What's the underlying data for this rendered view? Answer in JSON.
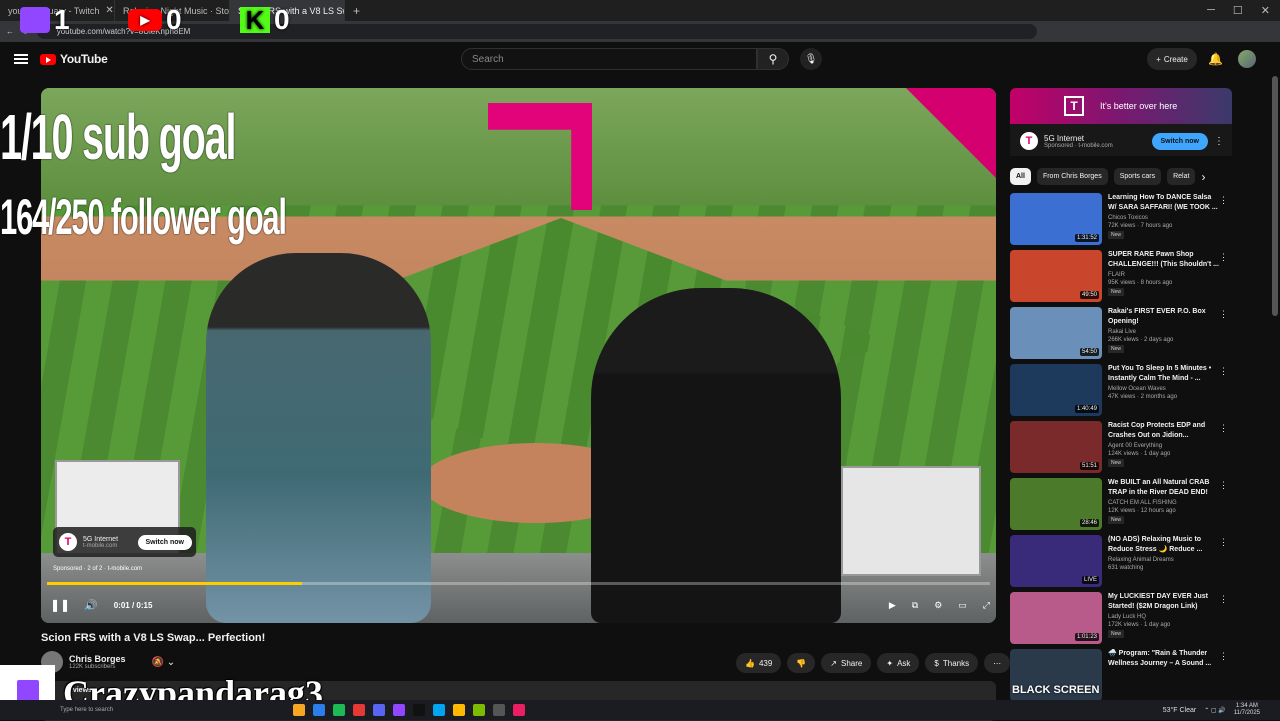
{
  "browser": {
    "tabs": [
      {
        "label": "yourSanctuary - Twitch",
        "active": false
      },
      {
        "label": "Relaxing Night Music · Stop",
        "active": false
      },
      {
        "label": "Scion FRS with a V8 LS Swap",
        "active": true
      }
    ],
    "url": "youtube.com/watch?v=8UleKnph8EM"
  },
  "stream_overlay": {
    "twitch_count": "1",
    "youtube_count": "0",
    "kick_count": "0",
    "sub_goal": "1/10 sub goal",
    "follower_goal": "164/250 follower goal",
    "streamer_name": "Crazypandarag3",
    "black_screen": "BLACK SCREEN"
  },
  "youtube_header": {
    "logo_text": "YouTube",
    "search_placeholder": "Search",
    "create_label": "Create"
  },
  "player": {
    "ad_brand": "5G Internet",
    "ad_url": "t-mobile.com",
    "ad_cta": "Switch now",
    "sponsored_text": "Sponsored · 2 of 2 · t-mobile.com",
    "time": "0:01 / 0:15",
    "progress": 0.27
  },
  "video": {
    "title": "Scion FRS with a V8 LS Swap... Perfection!",
    "channel": "Chris Borges",
    "subscribers": "122K subscribers",
    "likes": "439",
    "share_label": "Share",
    "ask_label": "Ask",
    "thanks_label": "Thanks",
    "views": "1 views"
  },
  "sidebar_ad": {
    "banner_text": "It's better over here",
    "title": "5G Internet",
    "sponsor": "Sponsored · t-mobile.com",
    "cta": "Switch now"
  },
  "chips": [
    "All",
    "From Chris Borges",
    "Sports cars",
    "Relat"
  ],
  "videos": [
    {
      "title": "Learning How To DANCE Salsa W/ SARA SAFFARI! (WE TOOK ...",
      "channel": "Chicos Toxicos",
      "stats": "72K views · 7 hours ago",
      "duration": "1:31:52",
      "badge": "New",
      "color": "#3b6fd1"
    },
    {
      "title": "SUPER RARE Pawn Shop CHALLENGE!!! (This Shouldn't ...",
      "channel": "FLAIR",
      "stats": "95K views · 8 hours ago",
      "duration": "49:50",
      "badge": "New",
      "color": "#c9452c"
    },
    {
      "title": "Rakai's FIRST EVER P.O. Box Opening!",
      "channel": "Rakai Live",
      "stats": "266K views · 2 days ago",
      "duration": "54:50",
      "badge": "New",
      "color": "#6a8fb8"
    },
    {
      "title": "Put You To Sleep In 5 Minutes • Instantly Calm The Mind - ...",
      "channel": "Mellow Ocean Waves",
      "stats": "47K views · 2 months ago",
      "duration": "1:40:49",
      "badge": "",
      "color": "#1d3a5c"
    },
    {
      "title": "Racist Cop Protects EDP and Crashes Out on Jidion...",
      "channel": "Agent 00 Everything",
      "stats": "124K views · 1 day ago",
      "duration": "51:51",
      "badge": "New",
      "color": "#7a2a2a"
    },
    {
      "title": "We BUILT an All Natural CRAB TRAP in the River DEAD END!",
      "channel": "CATCH EM ALL FISHING",
      "stats": "12K views · 12 hours ago",
      "duration": "28:46",
      "badge": "New",
      "color": "#4a7a2a"
    },
    {
      "title": "(NO ADS) Relaxing Music to Reduce Stress 🌙 Reduce ...",
      "channel": "Relaxing Animal Dreams",
      "stats": "631 watching",
      "duration": "LIVE",
      "badge": "",
      "color": "#3a2a7a"
    },
    {
      "title": "My LUCKIEST DAY EVER Just Started! ($2M Dragon Link)",
      "channel": "Lady Luck HQ",
      "stats": "172K views · 1 day ago",
      "duration": "1:01:23",
      "badge": "New",
      "color": "#b85a8a"
    },
    {
      "title": "🌧️ Program: \"Rain & Thunder Wellness Journey – A Sound ...",
      "channel": "",
      "stats": "",
      "duration": "",
      "badge": "",
      "color": "#2a3a4a"
    }
  ],
  "taskbar": {
    "search_text": "Type here to search",
    "weather": "53°F Clear",
    "time": "1:34 AM",
    "date": "11/7/2025"
  }
}
